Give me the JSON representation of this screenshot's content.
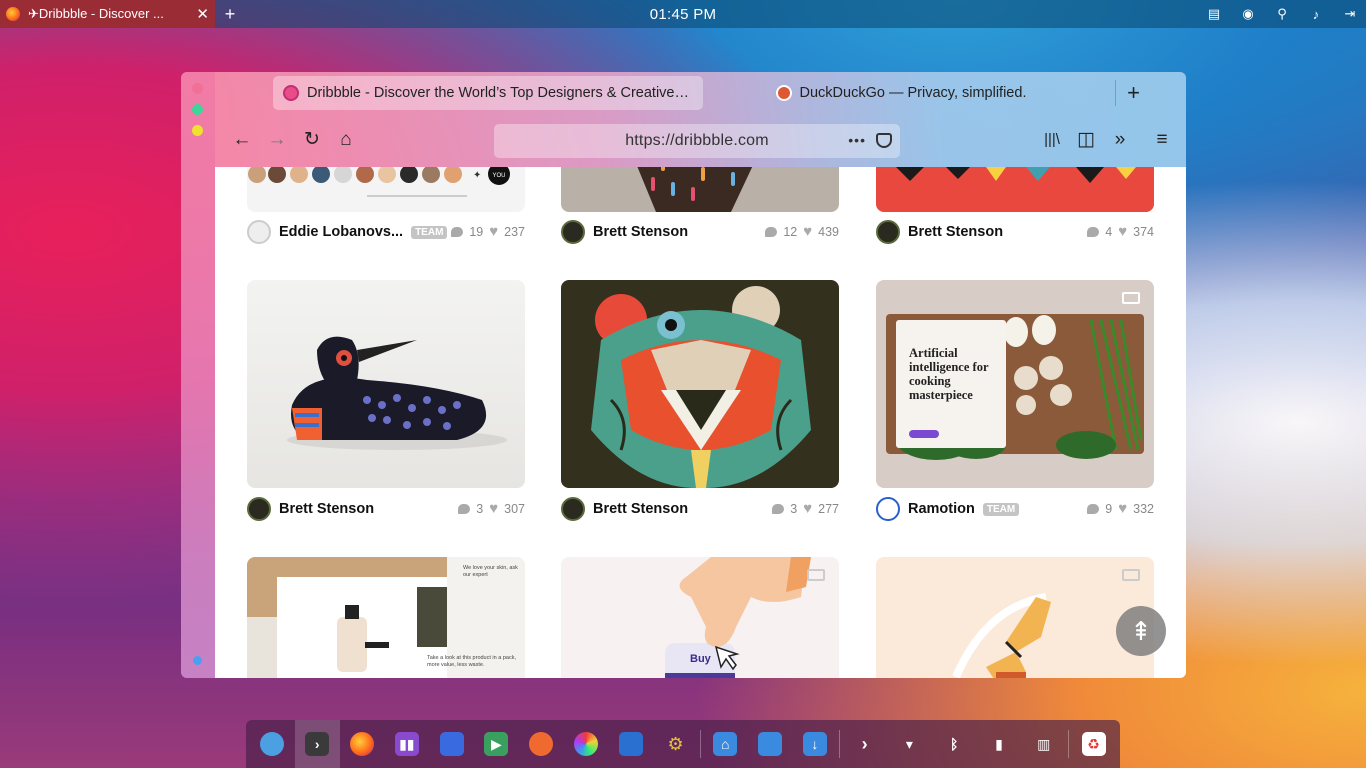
{
  "top_panel": {
    "tab_title": "✈Dribbble - Discover ...",
    "close": "✕",
    "new_tab": "+",
    "clock": "01:45 PM"
  },
  "browser": {
    "tabs": [
      {
        "label": "Dribbble - Discover the World’s Top Designers & Creative Professionals",
        "active": true
      },
      {
        "label": "DuckDuckGo — Privacy, simplified.",
        "active": false
      }
    ],
    "new_tab": "+",
    "url": "https://dribbble.com",
    "url_more": "•••"
  },
  "shots": [
    {
      "author": "Eddie Lobanovs...",
      "team": "TEAM",
      "comments": "19",
      "likes": "237",
      "video": false
    },
    {
      "author": "Brett Stenson",
      "team": "",
      "comments": "12",
      "likes": "439",
      "video": false
    },
    {
      "author": "Brett Stenson",
      "team": "",
      "comments": "4",
      "likes": "374",
      "video": false
    },
    {
      "author": "Brett Stenson",
      "team": "",
      "comments": "3",
      "likes": "307",
      "video": false
    },
    {
      "author": "Brett Stenson",
      "team": "",
      "comments": "3",
      "likes": "277",
      "video": false
    },
    {
      "author": "Ramotion",
      "team": "TEAM",
      "comments": "9",
      "likes": "332",
      "video": true
    }
  ],
  "shot_texts": {
    "you": "YOU",
    "ai_card_title": "Artificial intelligence for cooking masterpiece",
    "buy": "Buy",
    "web_card_1": "We love your skin, ask our expert",
    "web_card_2": "Take a look at this product in a pack, more value, less waste."
  },
  "dock": {
    "items": [
      "finder",
      "terminal",
      "firefox",
      "kanban",
      "files",
      "media-player",
      "games",
      "color-picker",
      "package",
      "settings",
      "home-folder",
      "documents-folder",
      "downloads-folder",
      "arrow",
      "wifi",
      "bluetooth",
      "battery",
      "panels",
      "trash"
    ]
  }
}
